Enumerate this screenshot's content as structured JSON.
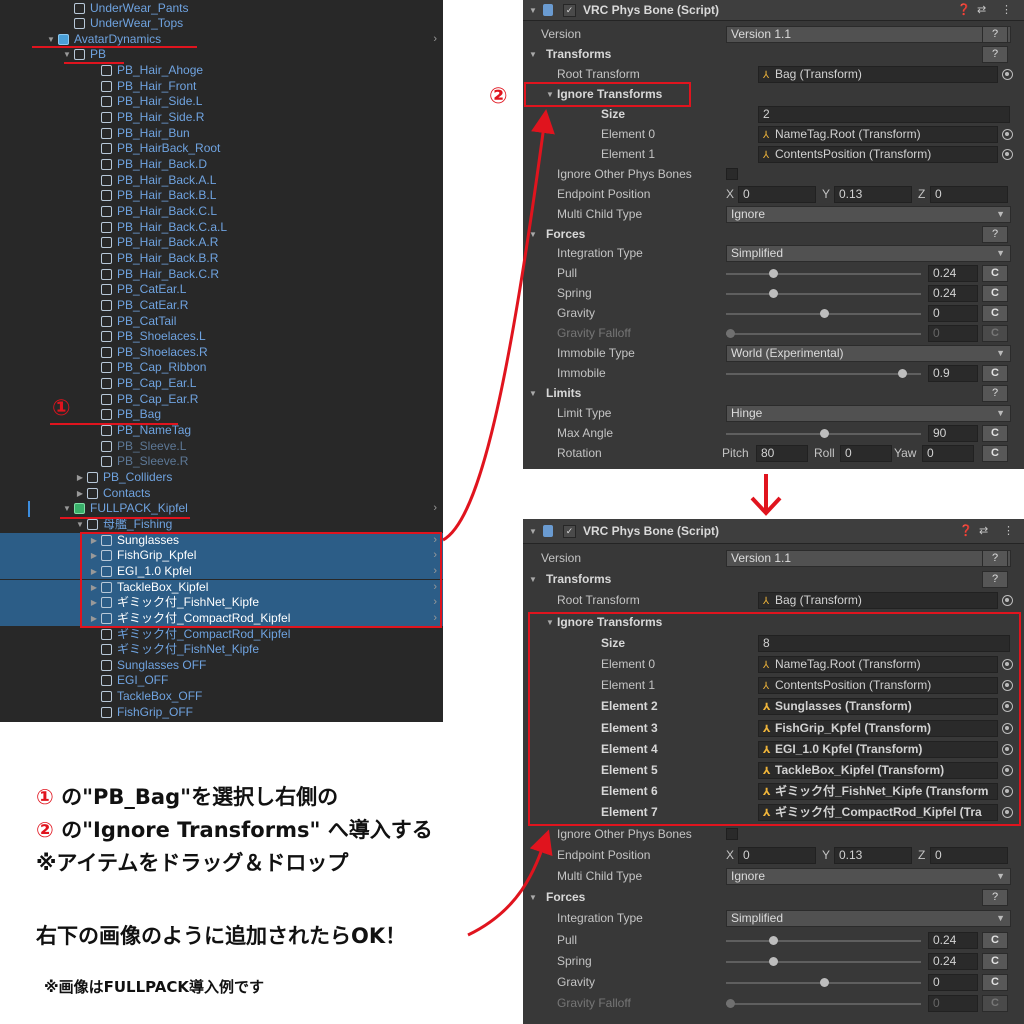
{
  "hierarchy": {
    "rows": [
      {
        "label": "UnderWear_Pants"
      },
      {
        "label": "UnderWear_Tops"
      },
      {
        "label": "AvatarDynamics"
      },
      {
        "label": "PB"
      },
      {
        "label": "PB_Hair_Ahoge"
      },
      {
        "label": "PB_Hair_Front"
      },
      {
        "label": "PB_Hair_Side.L"
      },
      {
        "label": "PB_Hair_Side.R"
      },
      {
        "label": "PB_Hair_Bun"
      },
      {
        "label": "PB_HairBack_Root"
      },
      {
        "label": "PB_Hair_Back.D"
      },
      {
        "label": "PB_Hair_Back.A.L"
      },
      {
        "label": "PB_Hair_Back.B.L"
      },
      {
        "label": "PB_Hair_Back.C.L"
      },
      {
        "label": "PB_Hair_Back.C.a.L"
      },
      {
        "label": "PB_Hair_Back.A.R"
      },
      {
        "label": "PB_Hair_Back.B.R"
      },
      {
        "label": "PB_Hair_Back.C.R"
      },
      {
        "label": "PB_CatEar.L"
      },
      {
        "label": "PB_CatEar.R"
      },
      {
        "label": "PB_CatTail"
      },
      {
        "label": "PB_Shoelaces.L"
      },
      {
        "label": "PB_Shoelaces.R"
      },
      {
        "label": "PB_Cap_Ribbon"
      },
      {
        "label": "PB_Cap_Ear.L"
      },
      {
        "label": "PB_Cap_Ear.R"
      },
      {
        "label": "PB_Bag"
      },
      {
        "label": "PB_NameTag"
      },
      {
        "label": "PB_Sleeve.L"
      },
      {
        "label": "PB_Sleeve.R"
      },
      {
        "label": "PB_Colliders"
      },
      {
        "label": "Contacts"
      },
      {
        "label": "FULLPACK_Kipfel"
      },
      {
        "label": "母艦_Fishing"
      },
      {
        "label": "Sunglasses"
      },
      {
        "label": "FishGrip_Kpfel"
      },
      {
        "label": "EGI_1.0 Kpfel"
      },
      {
        "label": "TackleBox_Kipfel"
      },
      {
        "label": "ギミック付_FishNet_Kipfe"
      },
      {
        "label": "ギミック付_CompactRod_Kipfel"
      },
      {
        "label": "ギミック付_CompactRod_Kipfel"
      },
      {
        "label": "ギミック付_FishNet_Kipfe"
      },
      {
        "label": "Sunglasses OFF"
      },
      {
        "label": "EGI_OFF"
      },
      {
        "label": "TackleBox_OFF"
      },
      {
        "label": "FishGrip_OFF"
      }
    ]
  },
  "inspector_top": {
    "title": "VRC Phys Bone (Script)",
    "version_label": "Version",
    "version_value": "Version 1.1",
    "transforms": "Transforms",
    "root_transform_label": "Root Transform",
    "root_transform_value": "Bag (Transform)",
    "ignore_transforms": "Ignore Transforms",
    "size_label": "Size",
    "size_value": "2",
    "elements": [
      {
        "label": "Element 0",
        "value": "NameTag.Root (Transform)"
      },
      {
        "label": "Element 1",
        "value": "ContentsPosition (Transform)"
      }
    ],
    "ignore_other_label": "Ignore Other Phys Bones",
    "endpoint_label": "Endpoint Position",
    "ex": "X",
    "exv": "0",
    "ey": "Y",
    "eyv": "0.13",
    "ez": "Z",
    "ezv": "0",
    "multi_child_label": "Multi Child Type",
    "multi_child_value": "Ignore",
    "forces": "Forces",
    "integration_label": "Integration Type",
    "integration_value": "Simplified",
    "pull_label": "Pull",
    "pull_value": "0.24",
    "pull_fraction": 0.24,
    "spring_label": "Spring",
    "spring_value": "0.24",
    "spring_fraction": 0.24,
    "gravity_label": "Gravity",
    "gravity_value": "0",
    "gravity_falloff_label": "Gravity Falloff",
    "gravity_falloff_value": "0",
    "immobile_type_label": "Immobile Type",
    "immobile_type_value": "World (Experimental)",
    "immobile_label": "Immobile",
    "immobile_value": "0.9",
    "immobile_fraction": 0.9,
    "limits": "Limits",
    "limit_type_label": "Limit Type",
    "limit_type_value": "Hinge",
    "max_angle_label": "Max Angle",
    "max_angle_value": "90",
    "rotation_label": "Rotation",
    "pitch": "Pitch",
    "pitch_v": "80",
    "roll": "Roll",
    "roll_v": "0",
    "yaw": "Yaw",
    "yaw_v": "0",
    "c": "C",
    "q": "?",
    "icons": [
      "help-icon",
      "preset-icon",
      "more-icon"
    ]
  },
  "inspector_bottom": {
    "title": "VRC Phys Bone (Script)",
    "version_label": "Version",
    "version_value": "Version 1.1",
    "transforms": "Transforms",
    "root_transform_label": "Root Transform",
    "root_transform_value": "Bag (Transform)",
    "ignore_transforms": "Ignore Transforms",
    "size_label": "Size",
    "size_value": "8",
    "elements": [
      {
        "label": "Element 0",
        "value": "NameTag.Root (Transform)"
      },
      {
        "label": "Element 1",
        "value": "ContentsPosition (Transform)"
      },
      {
        "label": "Element 2",
        "value": "Sunglasses (Transform)"
      },
      {
        "label": "Element 3",
        "value": "FishGrip_Kpfel (Transform)"
      },
      {
        "label": "Element 4",
        "value": "EGI_1.0 Kpfel (Transform)"
      },
      {
        "label": "Element 5",
        "value": "TackleBox_Kipfel (Transform)"
      },
      {
        "label": "Element 6",
        "value": "ギミック付_FishNet_Kipfe (Transform"
      },
      {
        "label": "Element 7",
        "value": "ギミック付_CompactRod_Kipfel (Tra"
      }
    ],
    "ignore_other_label": "Ignore Other Phys Bones",
    "endpoint_label": "Endpoint Position",
    "ex": "X",
    "exv": "0",
    "ey": "Y",
    "eyv": "0.13",
    "ez": "Z",
    "ezv": "0",
    "multi_child_label": "Multi Child Type",
    "multi_child_value": "Ignore",
    "forces": "Forces",
    "integration_label": "Integration Type",
    "integration_value": "Simplified",
    "pull_label": "Pull",
    "pull_value": "0.24",
    "pull_fraction": 0.24,
    "spring_label": "Spring",
    "spring_value": "0.24",
    "spring_fraction": 0.24,
    "gravity_label": "Gravity",
    "gravity_value": "0",
    "gravity_falloff_label": "Gravity Falloff",
    "gravity_falloff_value": "0",
    "c": "C",
    "q": "?"
  },
  "annotations": {
    "circle1": "①",
    "circle2": "②",
    "down_arrow": "↓",
    "line1_num": "①",
    "line1_text": " の\"PB_Bag\"を選択し右側の",
    "line2_num": "②",
    "line2_text": " の\"Ignore Transforms\" へ導入する",
    "line3": "※アイテムをドラッグ＆ドロップ",
    "line4": "右下の画像のように追加されたらOK！",
    "line5": "※画像はFULLPACK導入例です",
    "accent_color": "#e0141e"
  }
}
